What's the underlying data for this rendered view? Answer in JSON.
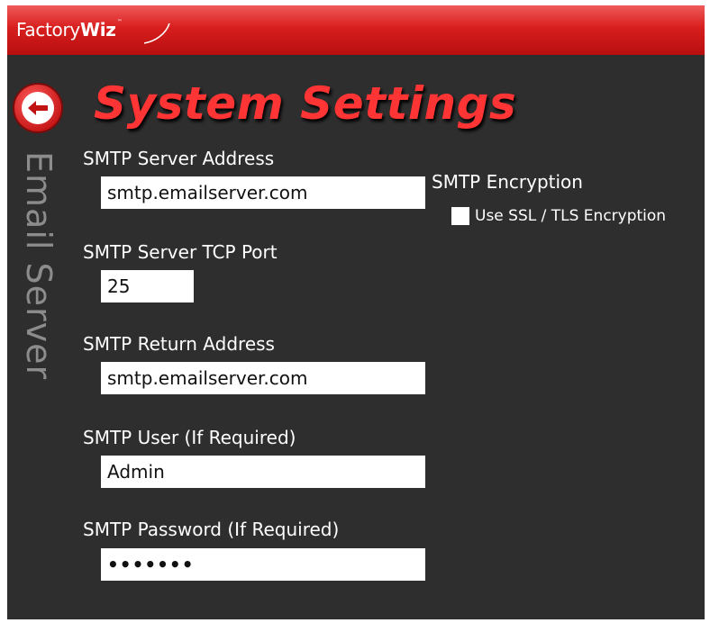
{
  "app": {
    "brand_part1": "Factory",
    "brand_part2": "Wiz",
    "brand_tm": "™",
    "accent_color": "#e01f1f",
    "title_color": "#ff3434"
  },
  "header": {
    "back_icon": "back-arrow-icon",
    "title": "System Settings"
  },
  "section": {
    "label": "Email Server"
  },
  "form": {
    "smtp_server_address": {
      "label": "SMTP Server Address",
      "value": "smtp.emailserver.com"
    },
    "smtp_server_port": {
      "label": "SMTP Server TCP Port",
      "value": "25"
    },
    "smtp_return_address": {
      "label": "SMTP Return Address",
      "value": "smtp.emailserver.com"
    },
    "smtp_user": {
      "label": "SMTP User (If Required)",
      "value": "Admin"
    },
    "smtp_password": {
      "label": "SMTP Password (If Required)",
      "value": "•••••••"
    }
  },
  "encryption": {
    "heading": "SMTP Encryption",
    "checkbox_label": "Use SSL / TLS Encryption",
    "checked": false
  }
}
